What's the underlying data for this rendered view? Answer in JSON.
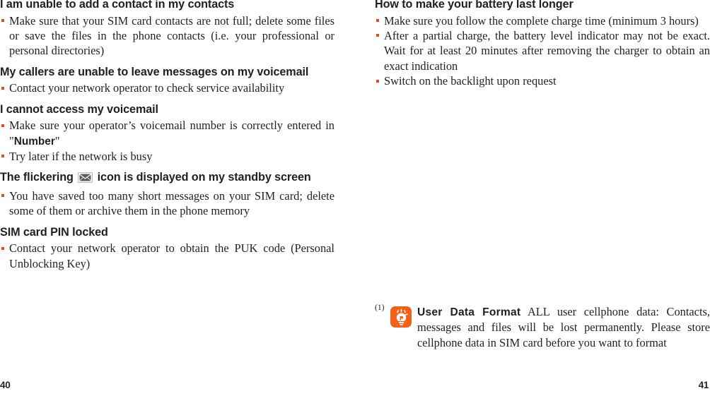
{
  "document": {
    "type": "user-manual-spread",
    "accent_color": "#e8491f",
    "tip_icon_color": "#f2601a",
    "text_color": "#231f20"
  },
  "left_page": {
    "folio": "40",
    "sections": [
      {
        "heading": "I am unable to add a contact in my contacts",
        "bullets": [
          "Make sure that your SIM card contacts are not full; delete some files or save the files in the phone contacts (i.e. your professional or personal directories)"
        ]
      },
      {
        "heading": "My callers are unable to leave messages on my voicemail",
        "bullets": [
          "Contact your network operator to check service availability"
        ]
      },
      {
        "heading": "I cannot access my voicemail",
        "bullets": [
          "Make sure your operator’s voicemail number is correctly entered in \"Number\"",
          "Try later if the network is busy"
        ]
      },
      {
        "heading_before_icon": "The flickering",
        "heading_icon": "envelope-icon",
        "heading_after_icon": "icon is displayed on my standby screen",
        "bullets": [
          "You have saved too many short messages on your SIM card; delete some of them or archive them in the phone memory"
        ]
      },
      {
        "heading": "SIM card PIN locked",
        "bullets": [
          "Contact your network operator to obtain the PUK code (Personal Unblocking Key)"
        ]
      }
    ]
  },
  "right_page": {
    "folio": "41",
    "sections": [
      {
        "heading": "How to make your battery last longer",
        "bullets": [
          "Make sure you follow the complete charge time (minimum 3 hours)",
          "After a partial charge, the battery level indicator may not be exact. Wait for at least 20 minutes after removing the charger to obtain an exact indication",
          "Switch on the backlight upon request"
        ]
      }
    ],
    "footnote": {
      "marker": "(1)",
      "icon": "tip-lightbulb-icon",
      "bold_lead": "User Data Format",
      "body": " ALL user cellphone data: Contacts, messages and files will be lost permanently. Please store cellphone data in SIM card before you want to format"
    }
  }
}
